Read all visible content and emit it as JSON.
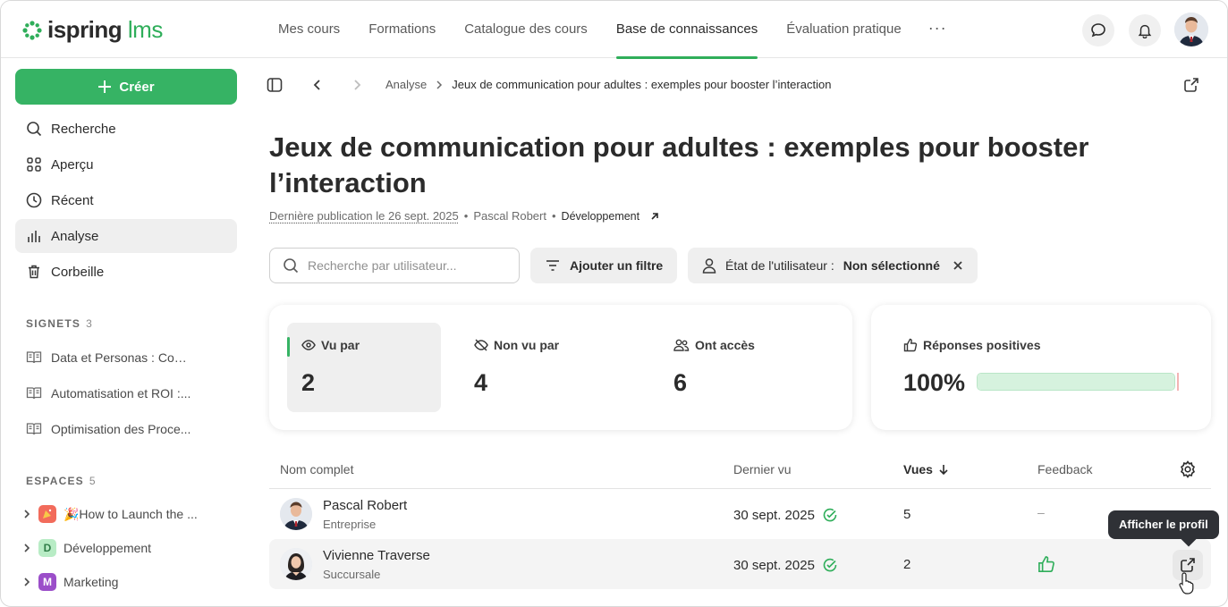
{
  "app": {
    "logo_main": "ispring",
    "logo_suffix": "lms"
  },
  "nav": {
    "items": [
      {
        "label": "Mes cours"
      },
      {
        "label": "Formations"
      },
      {
        "label": "Catalogue des cours"
      },
      {
        "label": "Base de connaissances",
        "active": true
      },
      {
        "label": "Évaluation pratique"
      }
    ],
    "more": "···"
  },
  "sidebar": {
    "create_label": "Créer",
    "items": [
      {
        "label": "Recherche",
        "icon": "search-icon"
      },
      {
        "label": "Aperçu",
        "icon": "grid-icon"
      },
      {
        "label": "Récent",
        "icon": "clock-icon"
      },
      {
        "label": "Analyse",
        "icon": "bar-chart-icon",
        "active": true
      },
      {
        "label": "Corbeille",
        "icon": "trash-icon"
      }
    ],
    "bookmarks": {
      "title": "SIGNETS",
      "count": "3",
      "items": [
        {
          "label": "Data et Personas : Com..."
        },
        {
          "label": "Automatisation et ROI :..."
        },
        {
          "label": "Optimisation des Proce..."
        }
      ]
    },
    "spaces": {
      "title": "ESPACES",
      "count": "5",
      "items": [
        {
          "label": "🎉How to Launch the ...",
          "badge": "",
          "color": "#f26b5b"
        },
        {
          "label": "Développement",
          "badge": "D",
          "color": "#b8ecc5"
        },
        {
          "label": "Marketing",
          "badge": "M",
          "color": "#9b4ec9"
        }
      ]
    }
  },
  "breadcrumb": {
    "parent": "Analyse",
    "current": "Jeux de communication pour adultes : exemples pour booster l’interaction"
  },
  "page": {
    "title": "Jeux de communication pour adultes : exemples pour booster l’interaction",
    "published": "Dernière publication le 26 sept. 2025",
    "author": "Pascal Robert",
    "space": "Développement"
  },
  "filters": {
    "search_placeholder": "Recherche par utilisateur...",
    "add_filter": "Ajouter un filtre",
    "user_state_label": "État de l'utilisateur :",
    "user_state_value": "Non sélectionné"
  },
  "stats": {
    "viewed_label": "Vu par",
    "viewed_value": "2",
    "not_viewed_label": "Non vu par",
    "not_viewed_value": "4",
    "access_label": "Ont accès",
    "access_value": "6",
    "positive_label": "Réponses positives",
    "positive_value": "100%",
    "positive_ratio": 1.0
  },
  "table": {
    "columns": [
      "Nom complet",
      "Dernier vu",
      "Vues",
      "Feedback"
    ],
    "rows": [
      {
        "name": "Pascal Robert",
        "sub": "Entreprise",
        "last_seen": "30 sept. 2025",
        "views": "5",
        "feedback": "–"
      },
      {
        "name": "Vivienne Traverse",
        "sub": "Succursale",
        "last_seen": "30 sept. 2025",
        "views": "2",
        "feedback": "thumbs-up"
      }
    ],
    "tooltip": "Afficher le profil"
  },
  "colors": {
    "brand_green": "#36b364",
    "accent_green": "#2fae5a"
  }
}
